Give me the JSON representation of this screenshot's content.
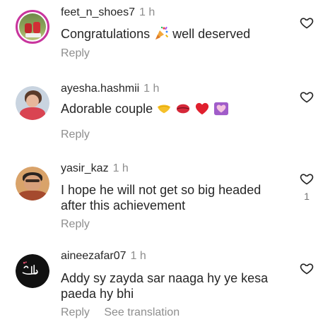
{
  "comments": [
    {
      "username": "feet_n_shoes7",
      "time": "1 h",
      "text": "Congratulations",
      "text_suffix": "well deserved",
      "emojis": [
        "party-popper-icon"
      ],
      "actions": {
        "reply": "Reply"
      }
    },
    {
      "username": "ayesha.hashmii",
      "time": "1 h",
      "text": "Adorable couple",
      "emojis": [
        "yellow-heart-icon",
        "kiss-mark-icon",
        "red-heart-icon",
        "heart-decoration-icon"
      ],
      "actions": {
        "reply": "Reply"
      }
    },
    {
      "username": "yasir_kaz",
      "time": "1 h",
      "text_line1": "I hope he will not get so big headed",
      "text_line2": "after this achievement",
      "likes": "1",
      "actions": {
        "reply": "Reply"
      }
    },
    {
      "username": "aineezafar07",
      "time": "1 h",
      "text_line1": "Addy sy zayda sar naaga hy ye kesa",
      "text_line2": "paeda hy bhi",
      "actions": {
        "reply": "Reply",
        "translate": "See translation"
      }
    }
  ],
  "colors": {
    "text": "#262626",
    "secondary": "#8e8e8e",
    "story_ring": "#c8359d"
  }
}
